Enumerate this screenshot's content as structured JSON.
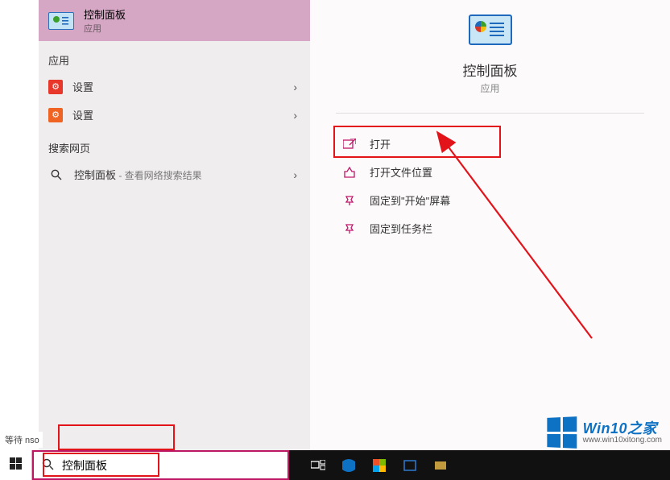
{
  "search_panel": {
    "best_match": {
      "title": "控制面板",
      "subtitle": "应用"
    },
    "sections": {
      "apps_header": "应用",
      "web_header": "搜索网页"
    },
    "items": {
      "settings1": "设置",
      "settings2": "设置",
      "web_search_title": "控制面板",
      "web_search_sub": " - 查看网络搜索结果"
    }
  },
  "detail_panel": {
    "title": "控制面板",
    "subtitle": "应用",
    "actions": {
      "open": "打开",
      "open_location": "打开文件位置",
      "pin_start": "固定到\"开始\"屏幕",
      "pin_taskbar": "固定到任务栏"
    }
  },
  "taskbar": {
    "search_value": "控制面板"
  },
  "status_text": "等待 nso",
  "watermark": {
    "title": "Win10之家",
    "url": "www.win10xitong.com"
  }
}
